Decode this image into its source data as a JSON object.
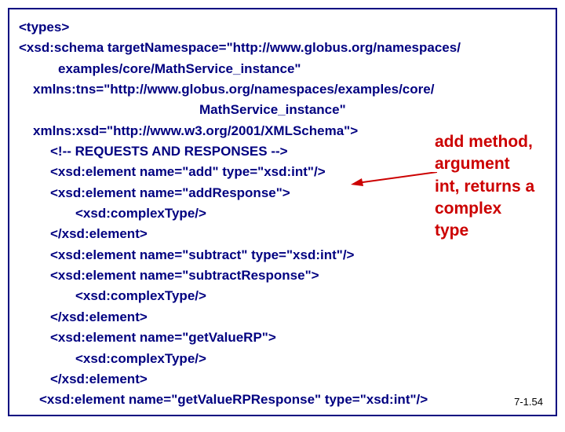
{
  "code": {
    "l0": "<types>",
    "l1": "<xsd:schema targetNamespace=\"http://www.globus.org/namespaces/",
    "l1b": "examples/core/MathService_instance\"",
    "l2": "xmlns:tns=\"http://www.globus.org/namespaces/examples/core/",
    "l2b": "MathService_instance\"",
    "l3": "xmlns:xsd=\"http://www.w3.org/2001/XMLSchema\">",
    "l4": "<!-- REQUESTS AND RESPONSES -->",
    "l5": "<xsd:element name=\"add\" type=\"xsd:int\"/>",
    "l6": "<xsd:element name=\"addResponse\">",
    "l7": "<xsd:complexType/>",
    "l8": "</xsd:element>",
    "l9": "<xsd:element name=\"subtract\" type=\"xsd:int\"/>",
    "l10": "<xsd:element name=\"subtractResponse\">",
    "l11": "<xsd:complexType/>",
    "l12": "</xsd:element>",
    "l13": "<xsd:element name=\"getValueRP\">",
    "l14": "<xsd:complexType/>",
    "l15": "</xsd:element>",
    "l16": "<xsd:element name=\"getValueRPResponse\" type=\"xsd:int\"/>"
  },
  "annotation": "add method, argument int, returns a complex type",
  "slide_number": "7-1.54"
}
